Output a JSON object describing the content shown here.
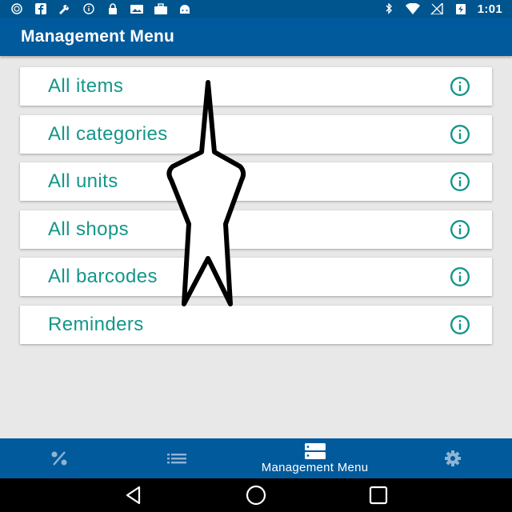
{
  "status_bar": {
    "time": "1:01",
    "left_icons": [
      "cast-icon",
      "facebook-icon",
      "tools-icon",
      "info-circle-icon",
      "lock-icon",
      "photo-icon",
      "briefcase-icon",
      "android-icon"
    ],
    "right_icons": [
      "bluetooth-icon",
      "wifi-icon",
      "signal-icon",
      "battery-icon"
    ]
  },
  "app_bar": {
    "title": "Management Menu"
  },
  "menu": {
    "items": [
      {
        "label": "All items"
      },
      {
        "label": "All categories"
      },
      {
        "label": "All units"
      },
      {
        "label": "All shops"
      },
      {
        "label": "All barcodes"
      },
      {
        "label": "Reminders"
      }
    ],
    "info_icon": "info-icon"
  },
  "bottom_nav": {
    "items": [
      {
        "icon": "percent-icon",
        "label": ""
      },
      {
        "icon": "list-icon",
        "label": ""
      },
      {
        "icon": "management-icon",
        "label": "Management Menu"
      },
      {
        "icon": "gear-icon",
        "label": ""
      }
    ],
    "active_index": 2
  },
  "system_nav": {
    "buttons": [
      "back-icon",
      "home-icon",
      "recents-icon"
    ]
  },
  "colors": {
    "primary": "#005a9c",
    "status_bar": "#00558f",
    "accent_text": "#14968a",
    "background": "#e8e8e8",
    "nav_inactive": "#8fb4d4"
  }
}
